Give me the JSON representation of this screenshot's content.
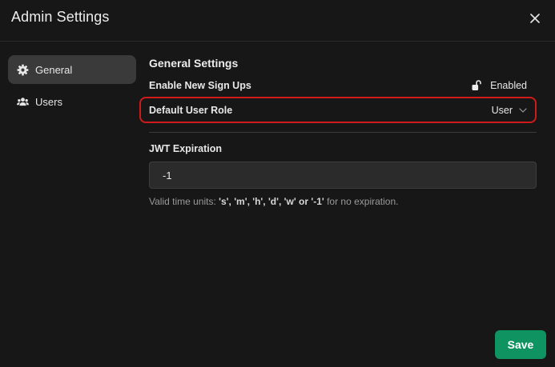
{
  "dialog": {
    "title": "Admin Settings",
    "close_icon": "close-icon"
  },
  "sidebar": {
    "items": [
      {
        "label": "General",
        "icon": "gear-icon",
        "active": true
      },
      {
        "label": "Users",
        "icon": "users-icon",
        "active": false
      }
    ]
  },
  "general": {
    "section_title": "General Settings",
    "signups": {
      "label": "Enable New Sign Ups",
      "value": "Enabled",
      "icon": "unlock-icon"
    },
    "default_role": {
      "label": "Default User Role",
      "value": "User",
      "icon": "chevron-down-icon"
    },
    "jwt": {
      "label": "JWT Expiration",
      "value": "-1",
      "hint_prefix": "Valid time units: ",
      "hint_units": "'s', 'm', 'h', 'd', 'w' or '-1'",
      "hint_suffix": " for no expiration."
    }
  },
  "footer": {
    "save_label": "Save"
  },
  "colors": {
    "background": "#171717",
    "active_nav": "#3a3a3a",
    "highlight_border": "#d11a1a",
    "save_button": "#0f9461"
  }
}
